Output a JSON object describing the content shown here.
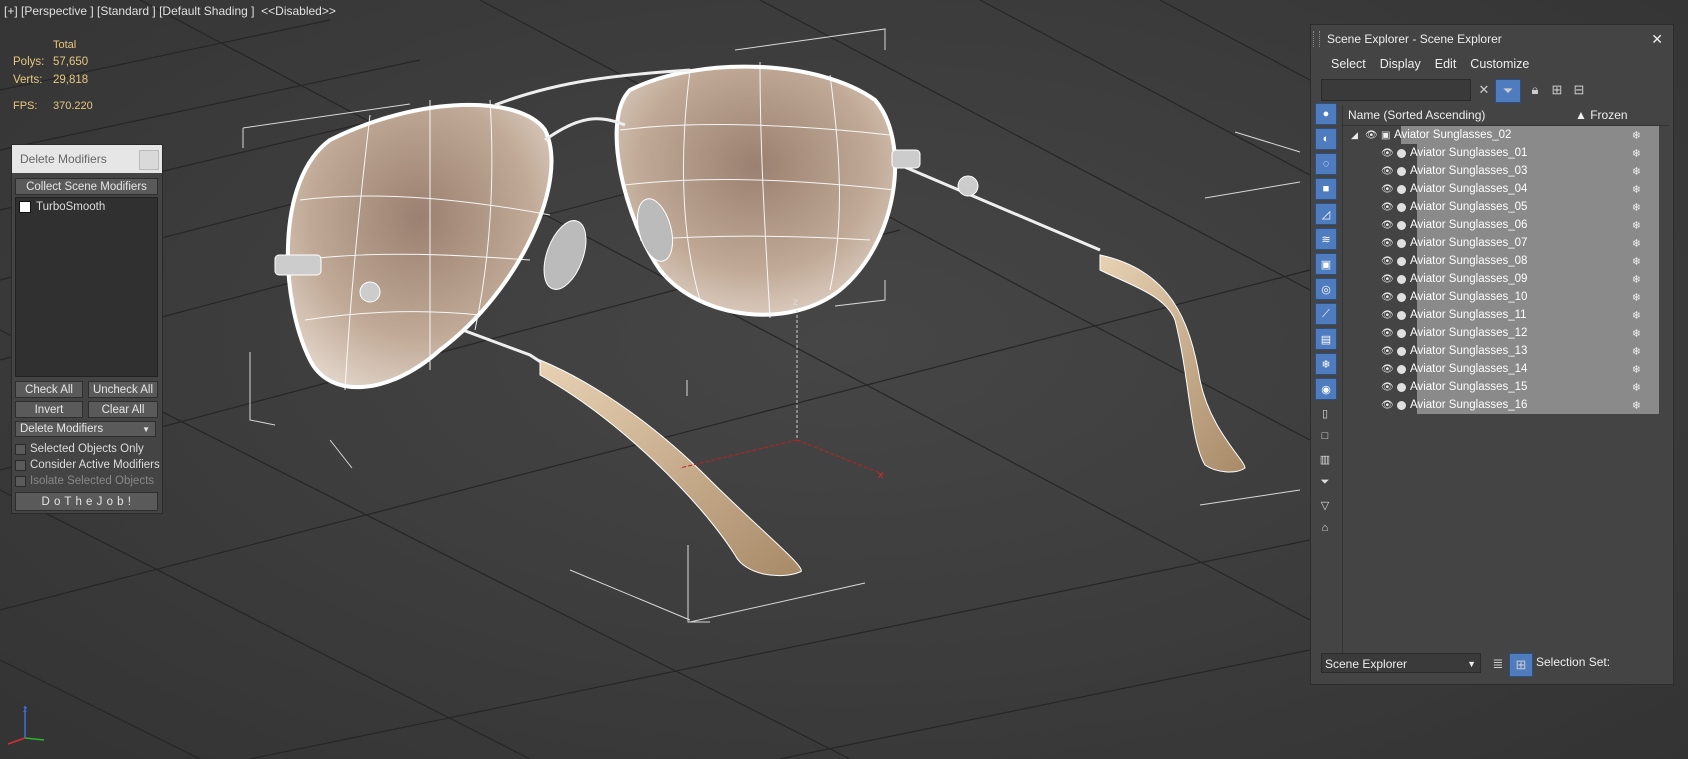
{
  "viewport": {
    "label": "[+] [Perspective ] [Standard ] [Default Shading ]  <<Disabled>>",
    "stats": {
      "total_label": "Total",
      "polys_label": "Polys:",
      "polys_value": "57,650",
      "verts_label": "Verts:",
      "verts_value": "29,818",
      "fps_label": "FPS:",
      "fps_value": "370.220"
    },
    "axis_labels": {
      "z": "z",
      "x": "x"
    }
  },
  "delete_modifiers": {
    "title": "Delete Modifiers",
    "collect_button": "Collect Scene Modifiers",
    "modifiers": [
      "TurboSmooth"
    ],
    "check_all": "Check All",
    "uncheck_all": "Uncheck All",
    "invert": "Invert",
    "clear_all": "Clear All",
    "mode_dropdown": "Delete Modifiers",
    "options": {
      "selected_only": "Selected Objects Only",
      "consider_active": "Consider Active Modifiers",
      "isolate_selected": "Isolate Selected Objects"
    },
    "do_button": "D o   T h e   J o b !"
  },
  "scene_explorer": {
    "title": "Scene Explorer - Scene Explorer",
    "close": "✕",
    "menu": [
      "Select",
      "Display",
      "Edit",
      "Customize"
    ],
    "columns": {
      "name": "Name (Sorted Ascending)",
      "frozen": "▲ Frozen"
    },
    "parent": "Aviator Sunglasses_02",
    "children": [
      "Aviator Sunglasses_01",
      "Aviator Sunglasses_03",
      "Aviator Sunglasses_04",
      "Aviator Sunglasses_05",
      "Aviator Sunglasses_06",
      "Aviator Sunglasses_07",
      "Aviator Sunglasses_08",
      "Aviator Sunglasses_09",
      "Aviator Sunglasses_10",
      "Aviator Sunglasses_11",
      "Aviator Sunglasses_12",
      "Aviator Sunglasses_13",
      "Aviator Sunglasses_14",
      "Aviator Sunglasses_15",
      "Aviator Sunglasses_16"
    ],
    "bottom_dropdown": "Scene Explorer",
    "selection_set_label": "Selection Set:"
  }
}
